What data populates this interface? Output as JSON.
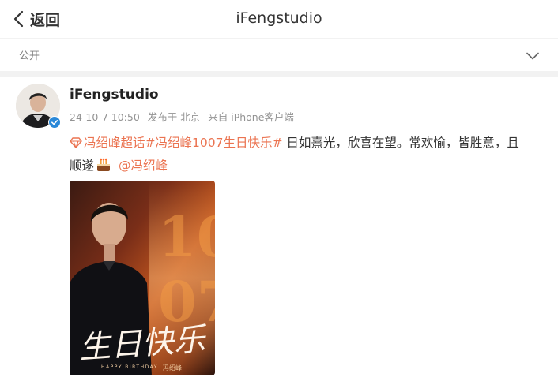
{
  "header": {
    "back_label": "返回",
    "title": "iFengstudio"
  },
  "visibility": {
    "label": "公开"
  },
  "post": {
    "author": "iFengstudio",
    "date": "24-10-7 10:50",
    "published_from": "发布于 北京",
    "device": "来自 iPhone客户端",
    "topic_super": "冯绍峰超话",
    "hashtag": "#冯绍峰1007生日快乐#",
    "text_line1": " 日如熹光，欣喜在望。常欢愉，皆胜意，且",
    "text_line2": "顺遂",
    "mention": "@冯绍峰",
    "image": {
      "big_text": "生日快乐",
      "small_text": "HAPPY BIRTHDAY",
      "name_text": "冯绍峰"
    }
  },
  "colors": {
    "link": "#eb7350",
    "meta": "#939393",
    "verified_blue": "#2a88d8"
  },
  "icons": {
    "back": "chevron-left-icon",
    "dropdown": "chevron-down-icon",
    "verified": "verified-badge-icon",
    "super_topic": "diamond-icon",
    "emoji": "birthday-cake-icon"
  }
}
